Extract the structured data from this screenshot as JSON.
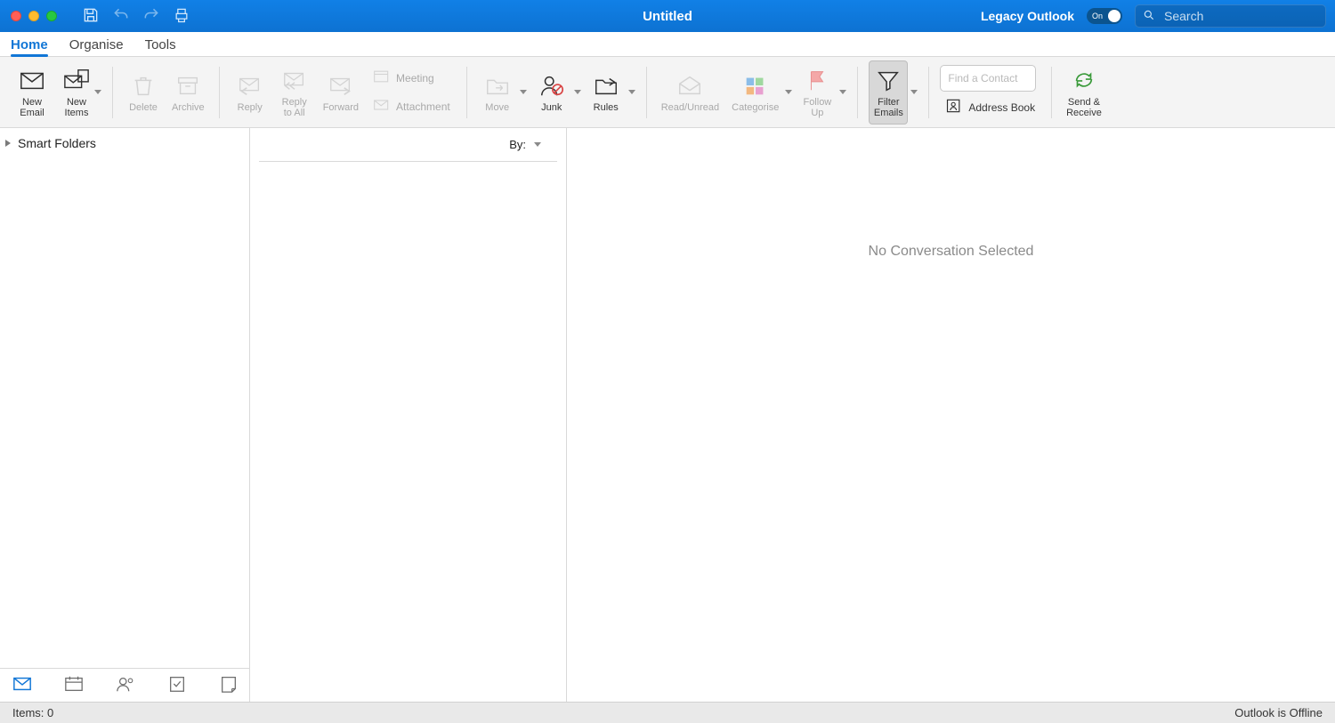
{
  "window": {
    "title": "Untitled",
    "legacy_label": "Legacy Outlook",
    "toggle_label": "On",
    "search_placeholder": "Search"
  },
  "tabs": {
    "home": "Home",
    "organise": "Organise",
    "tools": "Tools"
  },
  "ribbon": {
    "new_email": "New\nEmail",
    "new_items": "New\nItems",
    "delete": "Delete",
    "archive": "Archive",
    "reply": "Reply",
    "reply_all": "Reply\nto All",
    "forward": "Forward",
    "meeting": "Meeting",
    "attachment": "Attachment",
    "move": "Move",
    "junk": "Junk",
    "rules": "Rules",
    "read_unread": "Read/Unread",
    "categorise": "Categorise",
    "follow_up": "Follow\nUp",
    "filter_emails": "Filter\nEmails",
    "find_contact_placeholder": "Find a Contact",
    "address_book": "Address Book",
    "send_receive": "Send &\nReceive"
  },
  "sidebar": {
    "smart_folders": "Smart Folders"
  },
  "list": {
    "by_label": "By:"
  },
  "reading": {
    "empty_message": "No Conversation Selected"
  },
  "status": {
    "items_label": "Items: 0",
    "connection": "Outlook is Offline"
  }
}
